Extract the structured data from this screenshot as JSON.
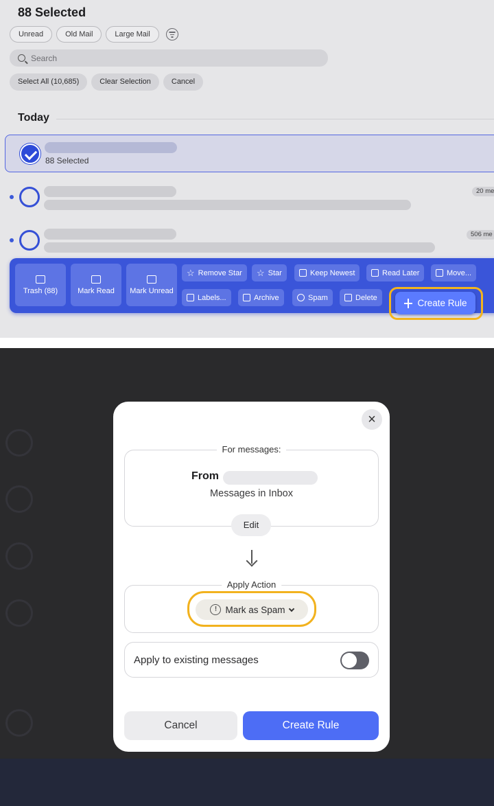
{
  "top": {
    "selection_title": "88 Selected",
    "filters": [
      "Unread",
      "Old Mail",
      "Large Mail"
    ],
    "search_placeholder": "Search",
    "select_all_label": "Select All (10,685)",
    "clear_selection_label": "Clear Selection",
    "cancel_label": "Cancel",
    "section_title": "Today",
    "selected_row_subtitle": "88 Selected",
    "row_counts": [
      "20 me",
      "506 me"
    ],
    "toolbar": {
      "trash": "Trash (88)",
      "mark_read": "Mark Read",
      "mark_unread": "Mark Unread",
      "remove_star": "Remove Star",
      "star": "Star",
      "keep_newest": "Keep Newest",
      "read_later": "Read Later",
      "move": "Move...",
      "labels": "Labels...",
      "archive": "Archive",
      "spam": "Spam",
      "delete": "Delete",
      "create_rule": "Create Rule"
    },
    "accent": "#3a55d9",
    "highlight": "#f3b41d"
  },
  "modal": {
    "for_messages_label": "For messages:",
    "from_label": "From",
    "scope": "Messages in Inbox",
    "edit_label": "Edit",
    "apply_action_label": "Apply Action",
    "action_value": "Mark as Spam",
    "apply_existing_label": "Apply to existing messages",
    "apply_existing_on": false,
    "cancel_label": "Cancel",
    "create_label": "Create Rule",
    "primary_color": "#4d6df5"
  }
}
